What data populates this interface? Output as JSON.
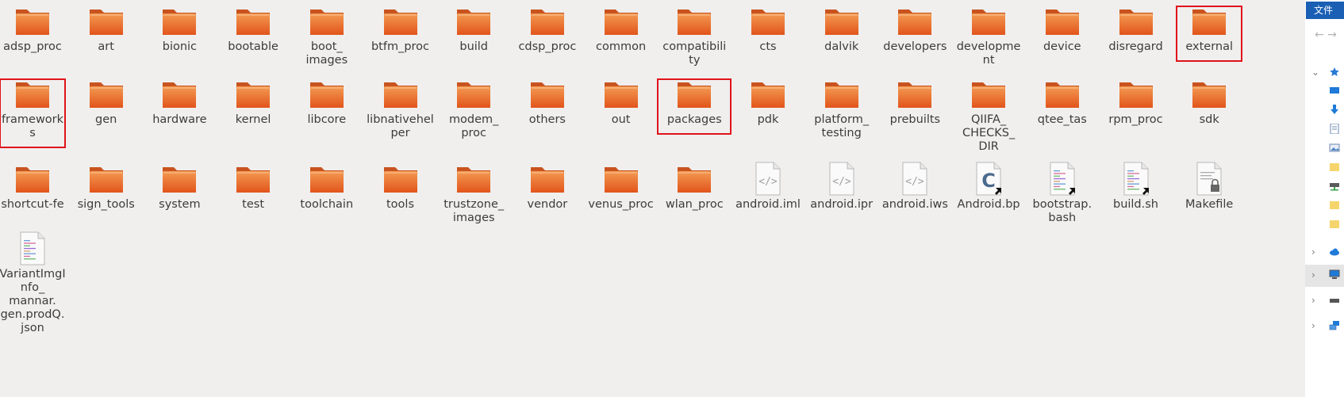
{
  "items": [
    {
      "label": "adsp_proc",
      "type": "folder"
    },
    {
      "label": "art",
      "type": "folder"
    },
    {
      "label": "bionic",
      "type": "folder"
    },
    {
      "label": "bootable",
      "type": "folder"
    },
    {
      "label": "boot_\nimages",
      "type": "folder"
    },
    {
      "label": "btfm_proc",
      "type": "folder"
    },
    {
      "label": "build",
      "type": "folder"
    },
    {
      "label": "cdsp_proc",
      "type": "folder"
    },
    {
      "label": "common",
      "type": "folder"
    },
    {
      "label": "compatibili\nty",
      "type": "folder"
    },
    {
      "label": "cts",
      "type": "folder"
    },
    {
      "label": "dalvik",
      "type": "folder"
    },
    {
      "label": "developers",
      "type": "folder"
    },
    {
      "label": "developme\nnt",
      "type": "folder"
    },
    {
      "label": "device",
      "type": "folder"
    },
    {
      "label": "disregard",
      "type": "folder"
    },
    {
      "label": "external",
      "type": "folder"
    },
    {
      "label": "framework\ns",
      "type": "folder"
    },
    {
      "label": "gen",
      "type": "folder"
    },
    {
      "label": "hardware",
      "type": "folder"
    },
    {
      "label": "kernel",
      "type": "folder"
    },
    {
      "label": "libcore",
      "type": "folder"
    },
    {
      "label": "libnativehel\nper",
      "type": "folder"
    },
    {
      "label": "modem_\nproc",
      "type": "folder"
    },
    {
      "label": "others",
      "type": "folder"
    },
    {
      "label": "out",
      "type": "folder"
    },
    {
      "label": "packages",
      "type": "folder"
    },
    {
      "label": "pdk",
      "type": "folder"
    },
    {
      "label": "platform_\ntesting",
      "type": "folder"
    },
    {
      "label": "prebuilts",
      "type": "folder"
    },
    {
      "label": "QIIFA_\nCHECKS_\nDIR",
      "type": "folder"
    },
    {
      "label": "qtee_tas",
      "type": "folder"
    },
    {
      "label": "rpm_proc",
      "type": "folder"
    },
    {
      "label": "sdk",
      "type": "folder"
    },
    {
      "label": "shortcut-fe",
      "type": "folder"
    },
    {
      "label": "sign_tools",
      "type": "folder"
    },
    {
      "label": "system",
      "type": "folder"
    },
    {
      "label": "test",
      "type": "folder"
    },
    {
      "label": "toolchain",
      "type": "folder"
    },
    {
      "label": "tools",
      "type": "folder"
    },
    {
      "label": "trustzone_\nimages",
      "type": "folder"
    },
    {
      "label": "vendor",
      "type": "folder"
    },
    {
      "label": "venus_proc",
      "type": "folder"
    },
    {
      "label": "wlan_proc",
      "type": "folder"
    },
    {
      "label": "android.iml",
      "type": "xml"
    },
    {
      "label": "android.ipr",
      "type": "xml"
    },
    {
      "label": "android.iws",
      "type": "xml"
    },
    {
      "label": "Android.bp",
      "type": "c-link"
    },
    {
      "label": "bootstrap.\nbash",
      "type": "script-link"
    },
    {
      "label": "build.sh",
      "type": "script-link"
    },
    {
      "label": "Makefile",
      "type": "locked"
    },
    {
      "label": "VariantImgI\nnfo_\nmannar.\ngen.prodQ.\njson",
      "type": "script"
    }
  ],
  "highlighted": [
    "external",
    "framework\ns",
    "packages"
  ],
  "side": {
    "tab_label": "文件",
    "nav_arrows": "← →"
  },
  "colors": {
    "highlight": "#e0131b",
    "folder_top": "#f39a52",
    "folder_bottom": "#e2541b",
    "tab": "#1a5fb4"
  }
}
